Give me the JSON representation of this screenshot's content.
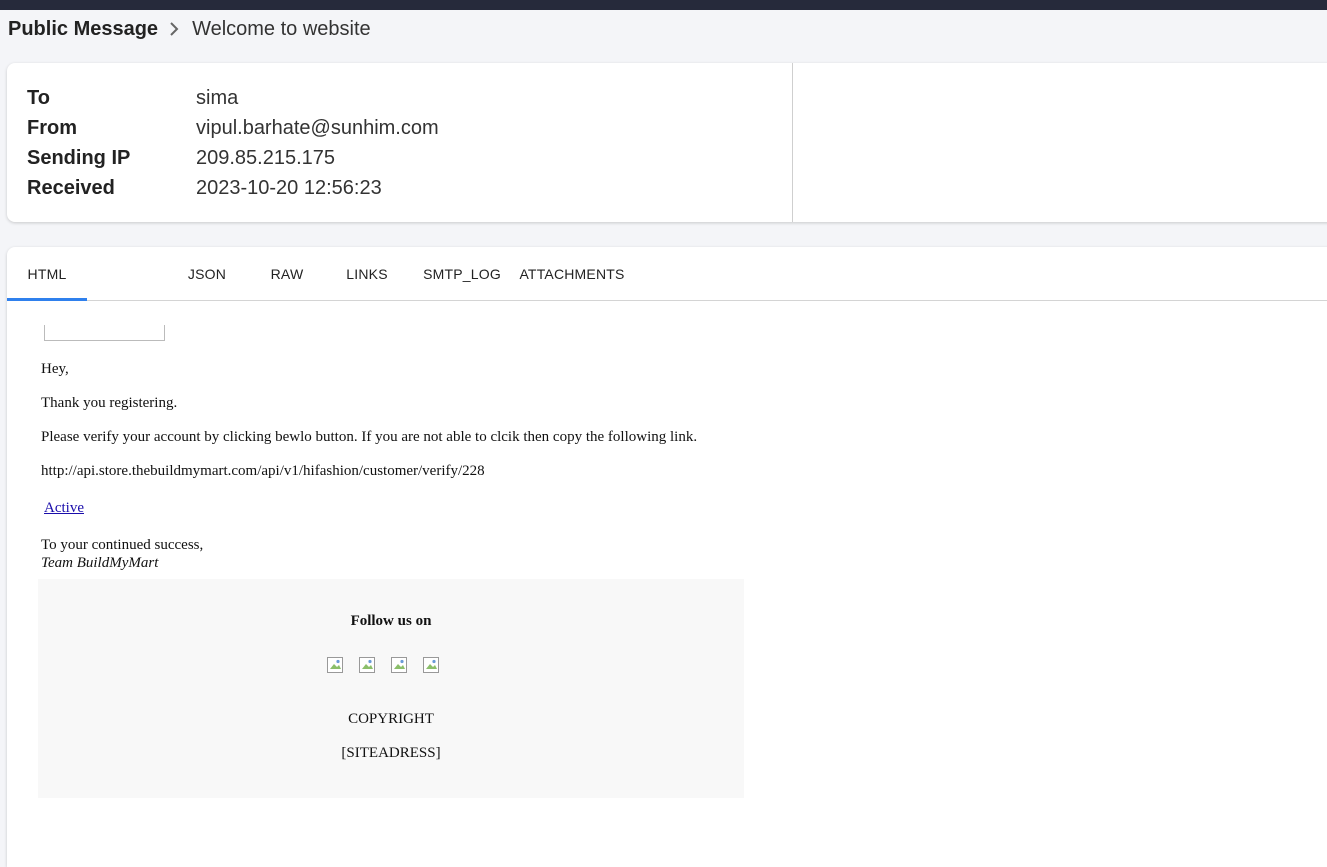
{
  "breadcrumb": {
    "root": "Public Message",
    "current": "Welcome to website"
  },
  "header": {
    "rows": [
      {
        "label": "To",
        "value": "sima"
      },
      {
        "label": "From",
        "value": "vipul.barhate@sunhim.com"
      },
      {
        "label": "Sending IP",
        "value": "209.85.215.175"
      },
      {
        "label": "Received",
        "value": "2023-10-20 12:56:23"
      }
    ]
  },
  "tabs": [
    {
      "label": "HTML",
      "active": true
    },
    {
      "label": "JSON",
      "active": false
    },
    {
      "label": "RAW",
      "active": false
    },
    {
      "label": "LINKS",
      "active": false
    },
    {
      "label": "SMTP_LOG",
      "active": false
    },
    {
      "label": "ATTACHMENTS",
      "active": false
    }
  ],
  "email": {
    "greeting": "Hey,",
    "thanks": "Thank you registering.",
    "instructions": "Please verify your account by clicking bewlo button. If you are not able to clcik then copy the following link.",
    "verify_url": "http://api.store.thebuildmymart.com/api/v1/hifashion/customer/verify/228",
    "active_link": "Active",
    "closing": "To your continued success,",
    "signature": "Team BuildMyMart",
    "footer": {
      "follow": "Follow us on",
      "copyright": "COPYRIGHT",
      "site_address": "[SITEADRESS]"
    }
  },
  "colors": {
    "topbar": "#262a3b",
    "tab_accent": "#2f80ed",
    "link": "#1a0dab"
  }
}
